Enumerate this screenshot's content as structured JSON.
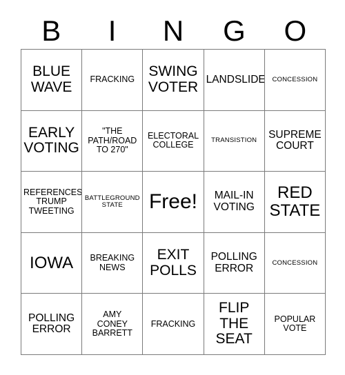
{
  "header": {
    "letters": [
      "B",
      "I",
      "N",
      "G",
      "O"
    ]
  },
  "grid": {
    "rows": [
      [
        {
          "text": "BLUE\nWAVE",
          "size": "lg"
        },
        {
          "text": "FRACKING",
          "size": "sm"
        },
        {
          "text": "SWING\nVOTER",
          "size": "lg"
        },
        {
          "text": "LANDSLIDE",
          "size": "md"
        },
        {
          "text": "CONCESSION",
          "size": "xs"
        }
      ],
      [
        {
          "text": "EARLY\nVOTING",
          "size": "lg"
        },
        {
          "text": "\"THE\nPATH/ROAD\nTO 270\"",
          "size": "sm"
        },
        {
          "text": "ELECTORAL\nCOLLEGE",
          "size": "sm"
        },
        {
          "text": "TRANSISTION",
          "size": "xs"
        },
        {
          "text": "SUPREME\nCOURT",
          "size": "md"
        }
      ],
      [
        {
          "text": "REFERENCES\nTRUMP\nTWEETING",
          "size": "sm"
        },
        {
          "text": "BATTLEGROUND\nSTATE",
          "size": "xs"
        },
        {
          "text": "Free!",
          "size": "free"
        },
        {
          "text": "MAIL-IN\nVOTING",
          "size": "md"
        },
        {
          "text": "RED\nSTATE",
          "size": "xl"
        }
      ],
      [
        {
          "text": "IOWA",
          "size": "xl"
        },
        {
          "text": "BREAKING\nNEWS",
          "size": "sm"
        },
        {
          "text": "EXIT\nPOLLS",
          "size": "lg"
        },
        {
          "text": "POLLING\nERROR",
          "size": "md"
        },
        {
          "text": "CONCESSION",
          "size": "xs"
        }
      ],
      [
        {
          "text": "POLLING\nERROR",
          "size": "md"
        },
        {
          "text": "AMY\nCONEY\nBARRETT",
          "size": "sm"
        },
        {
          "text": "FRACKING",
          "size": "sm"
        },
        {
          "text": "FLIP\nTHE\nSEAT",
          "size": "lg"
        },
        {
          "text": "POPULAR\nVOTE",
          "size": "sm"
        }
      ]
    ]
  },
  "colors": {
    "background": "#ffffff",
    "text": "#000000",
    "grid_line": "#7a7a7a"
  }
}
